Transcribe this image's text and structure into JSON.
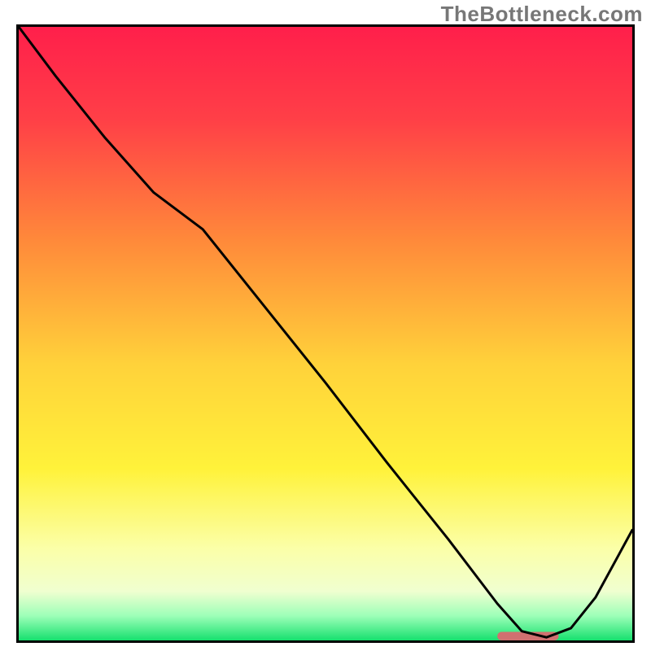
{
  "watermark": "TheBottleneck.com",
  "chart_data": {
    "type": "line",
    "title": "",
    "xlabel": "",
    "ylabel": "",
    "xlim": [
      0,
      100
    ],
    "ylim": [
      0,
      100
    ],
    "background_gradient": {
      "stops": [
        {
          "offset": 0.0,
          "color": "#ff1f4b"
        },
        {
          "offset": 0.15,
          "color": "#ff3f47"
        },
        {
          "offset": 0.35,
          "color": "#ff8a3a"
        },
        {
          "offset": 0.55,
          "color": "#ffd23a"
        },
        {
          "offset": 0.72,
          "color": "#fff23a"
        },
        {
          "offset": 0.85,
          "color": "#fbffa8"
        },
        {
          "offset": 0.92,
          "color": "#f0ffd0"
        },
        {
          "offset": 0.96,
          "color": "#9dffb8"
        },
        {
          "offset": 1.0,
          "color": "#16e06e"
        }
      ]
    },
    "series": [
      {
        "name": "bottleneck-curve",
        "color": "#000000",
        "x": [
          0.0,
          6.0,
          14.0,
          22.0,
          26.0,
          30.0,
          40.0,
          50.0,
          60.0,
          70.0,
          78.0,
          82.0,
          86.0,
          90.0,
          94.0,
          100.0
        ],
        "y": [
          100.0,
          92.0,
          82.0,
          73.0,
          70.0,
          67.0,
          54.5,
          42.0,
          29.0,
          16.5,
          6.0,
          1.5,
          0.5,
          2.0,
          7.0,
          18.0
        ]
      }
    ],
    "marker": {
      "name": "optimal-range-bar",
      "color": "#d07070",
      "x_start": 78.0,
      "x_end": 88.0,
      "y": 0.7,
      "thickness": 1.4
    }
  }
}
